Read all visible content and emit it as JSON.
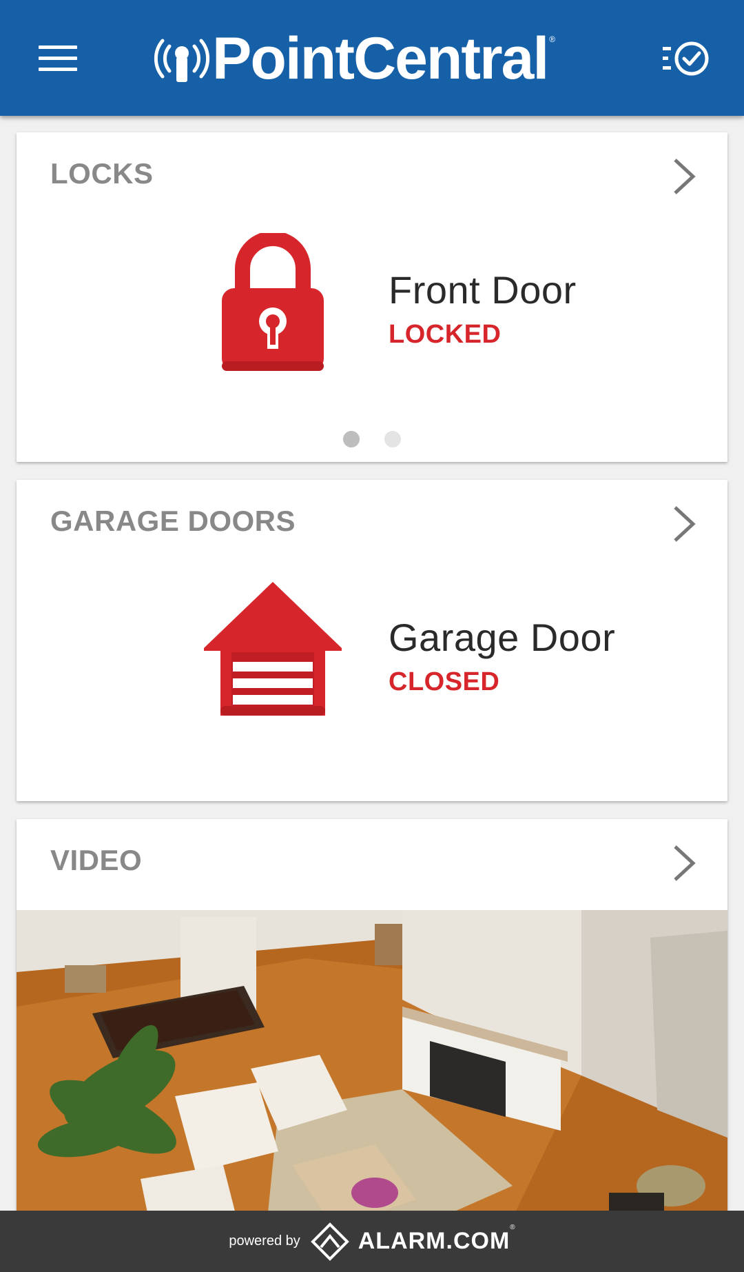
{
  "header": {
    "brand": "PointCentral",
    "brand_mark": "®",
    "color": "#1660a8"
  },
  "cards": {
    "locks": {
      "title": "LOCKS",
      "device_name": "Front Door",
      "device_status": "LOCKED",
      "icon": "padlock-icon",
      "page_count": 2,
      "current_page": 1
    },
    "garage": {
      "title": "GARAGE DOORS",
      "device_name": "Garage Door",
      "device_status": "CLOSED",
      "icon": "garage-door-icon"
    },
    "video": {
      "title": "VIDEO",
      "icon": "camera-feed"
    }
  },
  "footer": {
    "powered_by": "powered by",
    "partner": "ALARM.COM",
    "partner_mark": "®"
  },
  "colors": {
    "accent": "#1660a8",
    "status_red": "#d7262b",
    "title_grey": "#888888"
  }
}
